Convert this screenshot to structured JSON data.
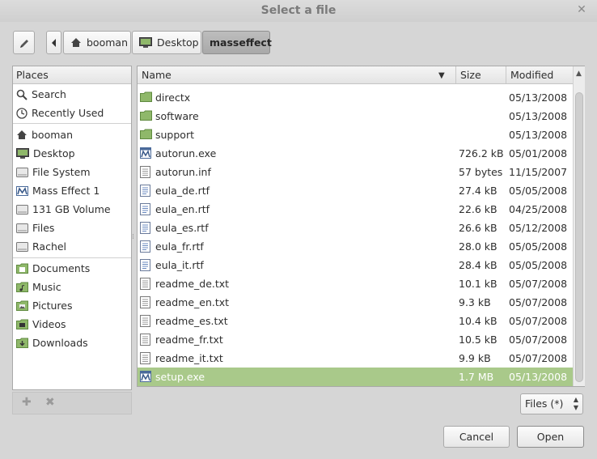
{
  "window": {
    "title": "Select a file"
  },
  "pathbar": {
    "crumbs": [
      {
        "label": "booman",
        "icon": "home-icon"
      },
      {
        "label": "Desktop",
        "icon": "desktop-icon"
      },
      {
        "label": "masseffect",
        "active": true
      }
    ]
  },
  "places": {
    "header": "Places",
    "items": [
      {
        "label": "Search",
        "icon": "search-icon"
      },
      {
        "label": "Recently Used",
        "icon": "clock-icon"
      },
      {
        "label": "booman",
        "icon": "home-icon"
      },
      {
        "label": "Desktop",
        "icon": "desktop-icon"
      },
      {
        "label": "File System",
        "icon": "drive-icon"
      },
      {
        "label": "Mass Effect 1",
        "icon": "disc-icon"
      },
      {
        "label": "131 GB Volume",
        "icon": "drive-icon"
      },
      {
        "label": "Files",
        "icon": "drive-icon"
      },
      {
        "label": "Rachel",
        "icon": "drive-icon"
      },
      {
        "label": "Documents",
        "icon": "folder-documents-icon"
      },
      {
        "label": "Music",
        "icon": "folder-music-icon"
      },
      {
        "label": "Pictures",
        "icon": "folder-pictures-icon"
      },
      {
        "label": "Videos",
        "icon": "folder-videos-icon"
      },
      {
        "label": "Downloads",
        "icon": "folder-downloads-icon"
      }
    ]
  },
  "files": {
    "columns": {
      "name": "Name",
      "size": "Size",
      "modified": "Modified"
    },
    "rows": [
      {
        "name": "directx",
        "size": "",
        "modified": "05/13/2008",
        "type": "folder"
      },
      {
        "name": "software",
        "size": "",
        "modified": "05/13/2008",
        "type": "folder"
      },
      {
        "name": "support",
        "size": "",
        "modified": "05/13/2008",
        "type": "folder"
      },
      {
        "name": "autorun.exe",
        "size": "726.2 kB",
        "modified": "05/01/2008",
        "type": "exe"
      },
      {
        "name": "autorun.inf",
        "size": "57 bytes",
        "modified": "11/15/2007",
        "type": "text"
      },
      {
        "name": "eula_de.rtf",
        "size": "27.4 kB",
        "modified": "05/05/2008",
        "type": "doc"
      },
      {
        "name": "eula_en.rtf",
        "size": "22.6 kB",
        "modified": "04/25/2008",
        "type": "doc"
      },
      {
        "name": "eula_es.rtf",
        "size": "26.6 kB",
        "modified": "05/12/2008",
        "type": "doc"
      },
      {
        "name": "eula_fr.rtf",
        "size": "28.0 kB",
        "modified": "05/05/2008",
        "type": "doc"
      },
      {
        "name": "eula_it.rtf",
        "size": "28.4 kB",
        "modified": "05/05/2008",
        "type": "doc"
      },
      {
        "name": "readme_de.txt",
        "size": "10.1 kB",
        "modified": "05/07/2008",
        "type": "text"
      },
      {
        "name": "readme_en.txt",
        "size": "9.3 kB",
        "modified": "05/07/2008",
        "type": "text"
      },
      {
        "name": "readme_es.txt",
        "size": "10.4 kB",
        "modified": "05/07/2008",
        "type": "text"
      },
      {
        "name": "readme_fr.txt",
        "size": "10.5 kB",
        "modified": "05/07/2008",
        "type": "text"
      },
      {
        "name": "readme_it.txt",
        "size": "9.9 kB",
        "modified": "05/07/2008",
        "type": "text"
      },
      {
        "name": "setup.exe",
        "size": "1.7 MB",
        "modified": "05/13/2008",
        "type": "exe",
        "selected": true
      }
    ]
  },
  "filter": {
    "selected": "Files (*)"
  },
  "buttons": {
    "cancel": "Cancel",
    "open": "Open"
  },
  "colors": {
    "selection": "#a9c98a",
    "folder": "#8fb86a",
    "background": "#d6d6d6"
  }
}
